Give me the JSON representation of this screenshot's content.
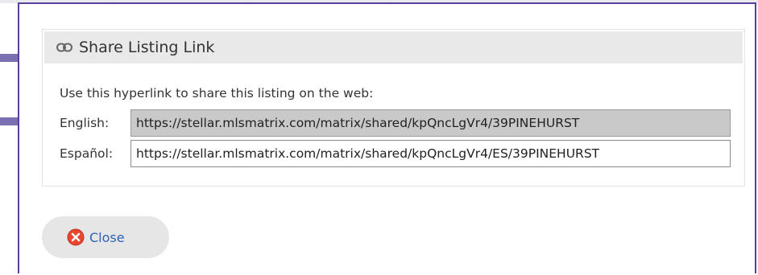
{
  "modal": {
    "title": "Share Listing Link",
    "intro": "Use this hyperlink to share this listing on the web:",
    "links": [
      {
        "label": "English:",
        "url": "https://stellar.mlsmatrix.com/matrix/shared/kpQncLgVr4/39PINEHURST"
      },
      {
        "label": "Español:",
        "url": "https://stellar.mlsmatrix.com/matrix/shared/kpQncLgVr4/ES/39PINEHURST"
      }
    ],
    "close_label": "Close"
  },
  "icons": {
    "title": "link-chain-icon",
    "close": "close-circle-icon"
  },
  "colors": {
    "frame_border": "#5a3e9c",
    "header_bg": "#e9e9e9",
    "selection": "#c9c9c9",
    "close_text": "#2a63b8",
    "close_icon": "#e8472f"
  }
}
